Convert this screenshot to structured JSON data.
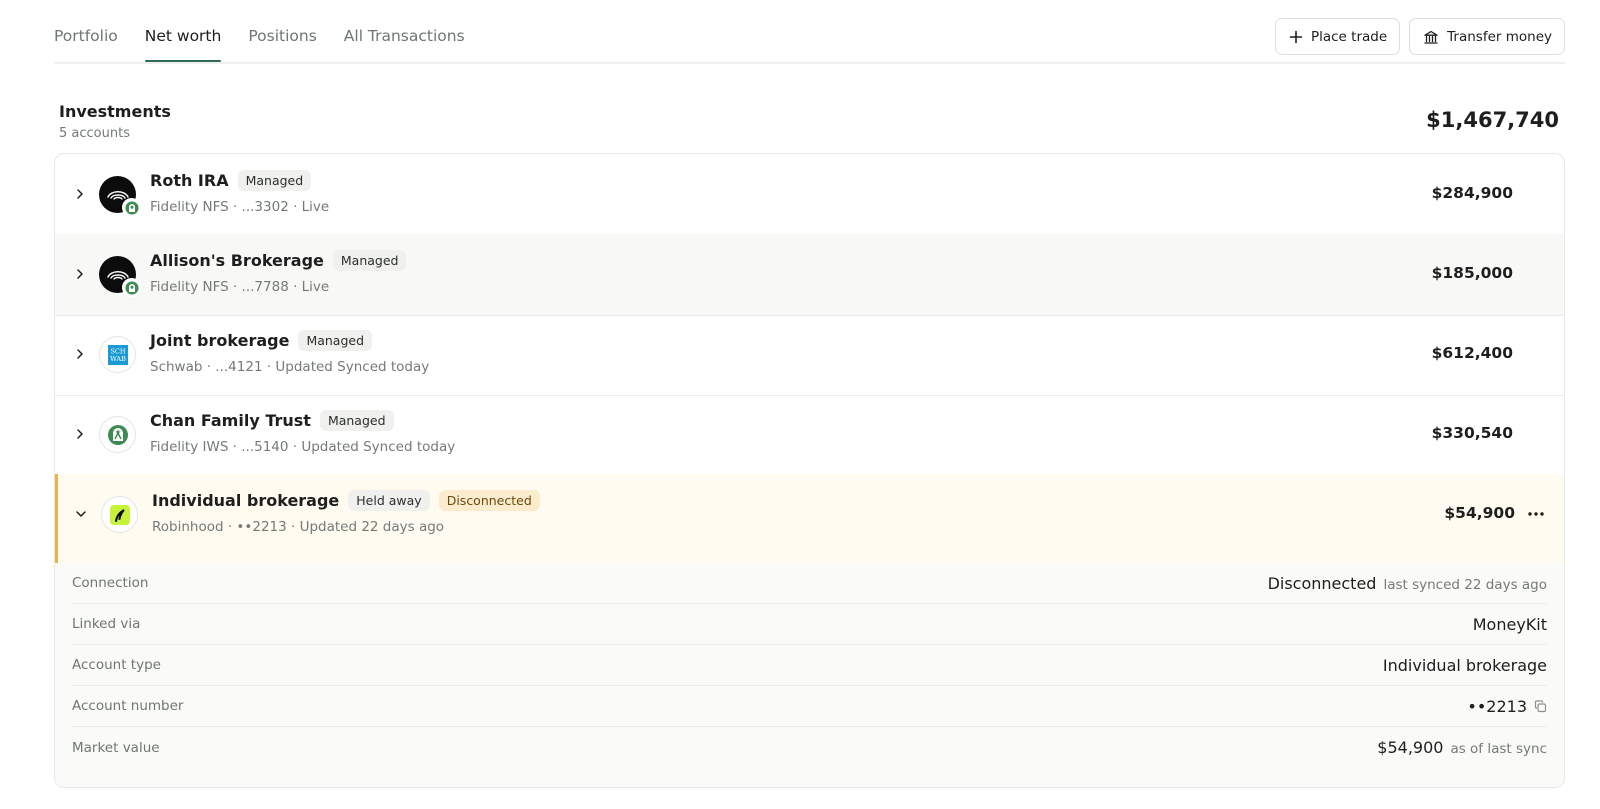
{
  "tabs": [
    {
      "label": "Portfolio",
      "active": false
    },
    {
      "label": "Net worth",
      "active": true
    },
    {
      "label": "Positions",
      "active": false
    },
    {
      "label": "All Transactions",
      "active": false
    }
  ],
  "actions": {
    "place_trade": {
      "label": "Place trade",
      "icon": "plus-icon"
    },
    "transfer_money": {
      "label": "Transfer money",
      "icon": "bank-icon"
    }
  },
  "section": {
    "title": "Investments",
    "subtitle": "5 accounts",
    "total": "$1,467,740"
  },
  "accounts": [
    {
      "name": "Roth IRA",
      "badges": [
        "Managed"
      ],
      "sub": "Fidelity NFS · ...3302 · Live",
      "amount": "$284,900",
      "logo": "fidelity-nfs-logo",
      "expanded": false
    },
    {
      "name": "Allison's Brokerage",
      "badges": [
        "Managed"
      ],
      "sub": "Fidelity NFS · ...7788 · Live",
      "amount": "$185,000",
      "logo": "fidelity-nfs-logo",
      "expanded": false
    },
    {
      "name": "Joint brokerage",
      "badges": [
        "Managed"
      ],
      "sub": "Schwab · ...4121 · Updated Synced today",
      "amount": "$612,400",
      "logo": "schwab-logo",
      "logo_text": [
        "SCH",
        "WAB"
      ],
      "expanded": false
    },
    {
      "name": "Chan Family Trust",
      "badges": [
        "Managed"
      ],
      "sub": "Fidelity IWS · ...5140 · Updated Synced today",
      "amount": "$330,540",
      "logo": "fidelity-iws-logo",
      "expanded": false
    },
    {
      "name": "Individual brokerage",
      "badges": [
        "Held away",
        "Disconnected"
      ],
      "sub": "Robinhood · ••2213 · Updated 22 days ago",
      "amount": "$54,900",
      "logo": "robinhood-logo",
      "expanded": true
    }
  ],
  "details": [
    {
      "label": "Connection",
      "value": "Disconnected",
      "note": "last synced 22 days ago"
    },
    {
      "label": "Linked via",
      "value": "MoneyKit",
      "note": ""
    },
    {
      "label": "Account type",
      "value": "Individual brokerage",
      "note": ""
    },
    {
      "label": "Account number",
      "value": "••2213",
      "note": ""
    },
    {
      "label": "Market value",
      "value": "$54,900",
      "note": "as of last sync"
    }
  ],
  "colors": {
    "accent": "#2f6a5a",
    "warning_border": "#e9b24a",
    "warning_bg": "#fffbf1",
    "badge_warn_bg": "#fbeccd",
    "robinhood_green": "#c7f23a",
    "schwab_blue": "#1a9ad6"
  }
}
